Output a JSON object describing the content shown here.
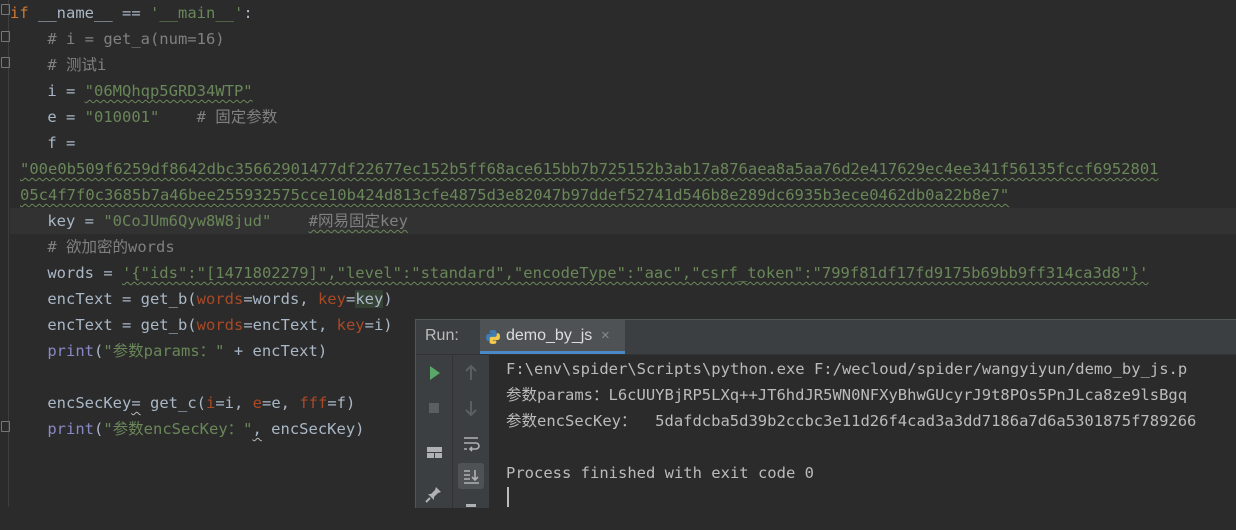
{
  "editor": {
    "lines": [
      {
        "html": "<span class='kw'>if</span> __name__ == <span class='str'>'__main__'</span>:"
      },
      {
        "html": "    <span class='cm'># i = get_a(num=16)</span>"
      },
      {
        "html": "    <span class='cm'># 测试i</span>"
      },
      {
        "html": "    i = <span class='str squiggle'>\"06MQhqp5GRD34WTP\"</span>"
      },
      {
        "html": "    e = <span class='str'>\"010001\"</span>    <span class='cm'># 固定参数</span>"
      },
      {
        "html": "    f ="
      },
      {
        "html": "<span class='str squiggle'>\"00e0b509f6259df8642dbc35662901477df22677ec152b5ff68ace615bb7b725152b3ab17a876aea8a5aa76d2e417629ec4ee341f56135fccf6952801</span>",
        "indent": 20
      },
      {
        "html": "<span class='str squiggle'>05c4f7f0c3685b7a46bee255932575cce10b424d813cfe4875d3e82047b97ddef52741d546b8e289dc6935b3ece0462db0a22b8e7\"</span>",
        "indent": 20
      },
      {
        "html": "    key = <span class='str'>\"0CoJUm6Qyw8W8jud\"</span>    <span class='cm squiggle'>#网易固定key</span>",
        "current": true
      },
      {
        "html": "    <span class='cm'># 欲加密的words</span>"
      },
      {
        "html": "    words = <span class='str squiggle'>'{\"ids\":\"[1471802279]\",\"level\":\"standard\",\"encodeType\":\"aac\",\"csrf_token\":\"799f81df17fd9175b69bb9ff314ca3d8\"}'</span>"
      },
      {
        "html": "    encText = get_b(<span class='param'>words</span>=words, <span class='param'>key</span>=<span class='hl'>key</span>)"
      },
      {
        "html": "    encText = get_b(<span class='param'>words</span>=encText, <span class='param'>key</span>=i)"
      },
      {
        "html": "    <span class='fn'>print</span>(<span class='str'>\"参数params：\"</span> + encText)"
      },
      {
        "html": ""
      },
      {
        "html": "    encSecKey<span class='squiggle' style='text-decoration-color:#bbb'>=</span> get_c(<span class='param'>i</span>=i, <span class='param'>e</span>=e, <span class='param'>fff</span>=f)"
      },
      {
        "html": "    <span class='fn'>print</span>(<span class='str'>\"参数encSecKey：\"</span><span class='squiggle' style='text-decoration-color:#bbb'>,</span> encSecKey)"
      }
    ]
  },
  "run_panel": {
    "label": "Run:",
    "tab_label": "demo_by_js",
    "close_glyph": "×",
    "output": [
      "F:\\env\\spider\\Scripts\\python.exe F:/wecloud/spider/wangyiyun/demo_by_js.p",
      "参数params：L6cUUYBjRP5LXq++JT6hdJR5WN0NFXyBhwGUcyrJ9t8POs5PnJLca8ze9lsBgq",
      "参数encSecKey：  5dafdcba5d39b2ccbc3e11d26f4cad3a3dd7186a7d6a5301875f789266",
      "",
      "Process finished with exit code 0"
    ]
  },
  "colors": {
    "background": "#2b2b2b",
    "keyword": "#cc7832",
    "string": "#6a8759",
    "comment": "#808080",
    "builtin": "#8888c6",
    "param": "#aa4926",
    "run_green": "#59a869",
    "tab_accent": "#4a88c7"
  }
}
